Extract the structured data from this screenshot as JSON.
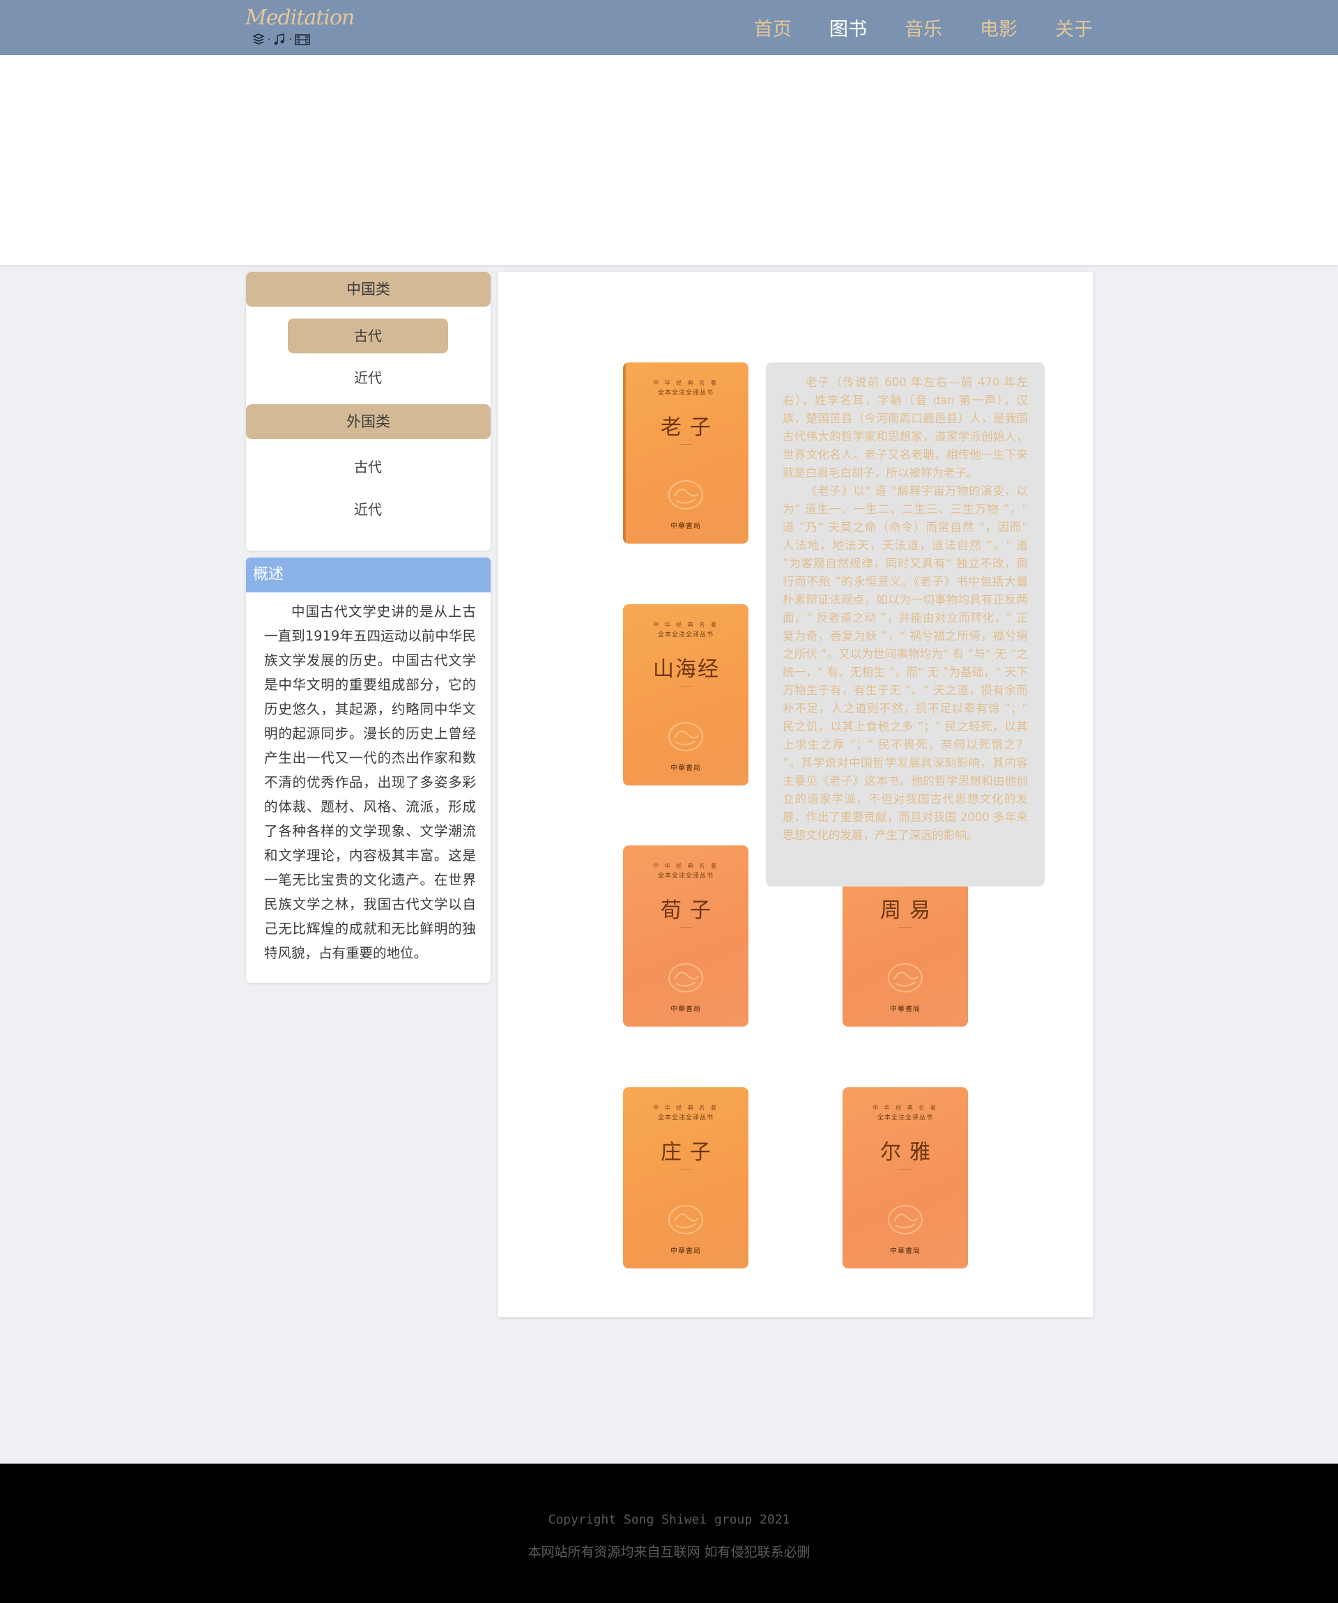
{
  "header": {
    "logo_text": "Meditation",
    "nav": [
      "首页",
      "图书",
      "音乐",
      "电影",
      "关于"
    ],
    "active_nav": "图书",
    "colors": {
      "bar": "#7b93b0",
      "nav_text": "#e3c79a",
      "nav_active": "#ffffff"
    }
  },
  "categories": {
    "chinese": {
      "label": "中国类",
      "items": [
        "古代",
        "近代"
      ],
      "active": "古代"
    },
    "foreign": {
      "label": "外国类",
      "items": [
        "古代",
        "近代"
      ]
    }
  },
  "overview": {
    "title": "概述",
    "text": "中国古代文学史讲的是从上古一直到1919年五四运动以前中华民族文学发展的历史。中国古代文学是中华文明的重要组成部分，它的历史悠久，其起源，约略同中华文明的起源同步。漫长的历史上曾经产生出一代又一代的杰出作家和数不清的优秀作品，出现了多姿多彩的体裁、题材、风格、流派，形成了各种各样的文学现象、文学潮流和文学理论，内容极其丰富。这是一笔无比宝贵的文化遗产。在世界民族文学之林，我国古代文学以自己无比辉煌的成就和无比鲜明的独特风貌，占有重要的地位。"
  },
  "books": [
    {
      "title": "老子"
    },
    {
      "title": "山海经"
    },
    {
      "title": "荀子"
    },
    {
      "title": "周易"
    },
    {
      "title": "庄子"
    },
    {
      "title": "尔雅"
    }
  ],
  "book_cover": {
    "series_top": "中 华 经 典 名 著",
    "series": "全本全注全译丛书",
    "publisher": "中華書局"
  },
  "tooltip": {
    "p1": "老子（传说前 600 年左右—前 470 年左右），姓李名耳，字聃（音 dan 第一声），汉族，楚国苦县（今河南周口鹿邑县）人，是我国古代伟大的哲学家和思想家，道家学派创始人，世界文化名人。老子又名老聃，相传他一生下来就是白眉毛白胡子，所以被称为老子。",
    "p2": "《老子》以“ 道 ”解释宇宙万物的演变，以为“ 道生一、一生二、二生三、三生万物 ”，“ 道 ”乃“ 夫莫之命（命令）而常自然 ”，因而“ 人法地，地法天，天法道，道法自然 ”。“ 道 ”为客观自然规律，同时又具有“ 独立不改，周行而不殆 ”的永恒意义。《老子》书中包括大量朴素辩证法观点，如以为一切事物均具有正反两面，“ 反者道之动 ”，并能由对立而转化，“ 正复为奇，善复为妖 ”，“ 祸兮福之所倚，福兮祸之所伏 ”。又以为世间事物均为“ 有 ”与“ 无 ”之统一，“ 有、无相生 ”，而“ 无 ”为基础，“ 天下万物生于有，有生于无 ”。“ 天之道，损有余而补不足，人之道则不然，损不足以奉有馀 ”；“ 民之饥，以其上食税之多 ”；“ 民之轻死，以其上求生之厚 ”；“ 民不畏死，奈何以死惧之？ ”。其学说对中国哲学发展具深刻影响，其内容主要见《老子》这本书。他的哲学思想和由他创立的道家学派，不但对我国古代思想文化的发展，作出了重要贡献，而且对我国 2000 多年来思想文化的发展，产生了深远的影响。"
  },
  "footer": {
    "copyright": "Copyright Song Shiwei group 2021",
    "note": "本网站所有资源均来自互联网 如有侵犯联系必删"
  }
}
